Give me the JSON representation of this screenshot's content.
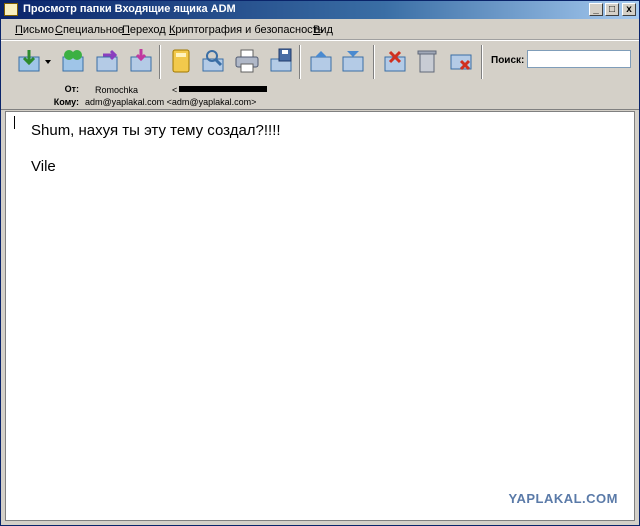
{
  "window": {
    "title": "Просмотр папки Входящие ящика ADM",
    "controls": {
      "minimize": "_",
      "maximize": "□",
      "close": "x"
    }
  },
  "menu": [
    {
      "label": "Письмо",
      "accel": "П",
      "rest": "исьмо"
    },
    {
      "label": "Специальное",
      "accel": "С",
      "rest": "пециальное"
    },
    {
      "label": "Переход",
      "accel": "П",
      "rest": "ереход"
    },
    {
      "label": "Криптография и безопасность",
      "accel": "К",
      "rest": "риптография и безопасность"
    },
    {
      "label": "Вид",
      "accel": "В",
      "rest": "ид"
    }
  ],
  "toolbar": {
    "buttons": [
      "get-mail-icon",
      "dropdown-arrow-icon",
      "reply-all-icon",
      "forward-icon",
      "move-icon",
      "address-book-icon",
      "search-mail-icon",
      "print-icon",
      "save-icon",
      "previous-icon",
      "next-icon",
      "delete-message-icon",
      "trash-icon",
      "junk-icon"
    ],
    "search_label": "Поиск:",
    "search_value": ""
  },
  "headers": {
    "from_label": "От:",
    "from_name": "Romochka",
    "from_email_prefix": "<",
    "to_label": "Кому:",
    "to_value": "adm@yaplakal.com <adm@yaplakal.com>"
  },
  "message": {
    "lines": [
      "Shum, нахуя ты эту тему создал?!!!!",
      "Vile"
    ]
  },
  "watermark": "YAPLAKAL.COM",
  "colors": {
    "title_start": "#0a246a",
    "title_end": "#a6caf0",
    "chrome": "#d4d0c8",
    "watermark": "#5a7aa8"
  }
}
